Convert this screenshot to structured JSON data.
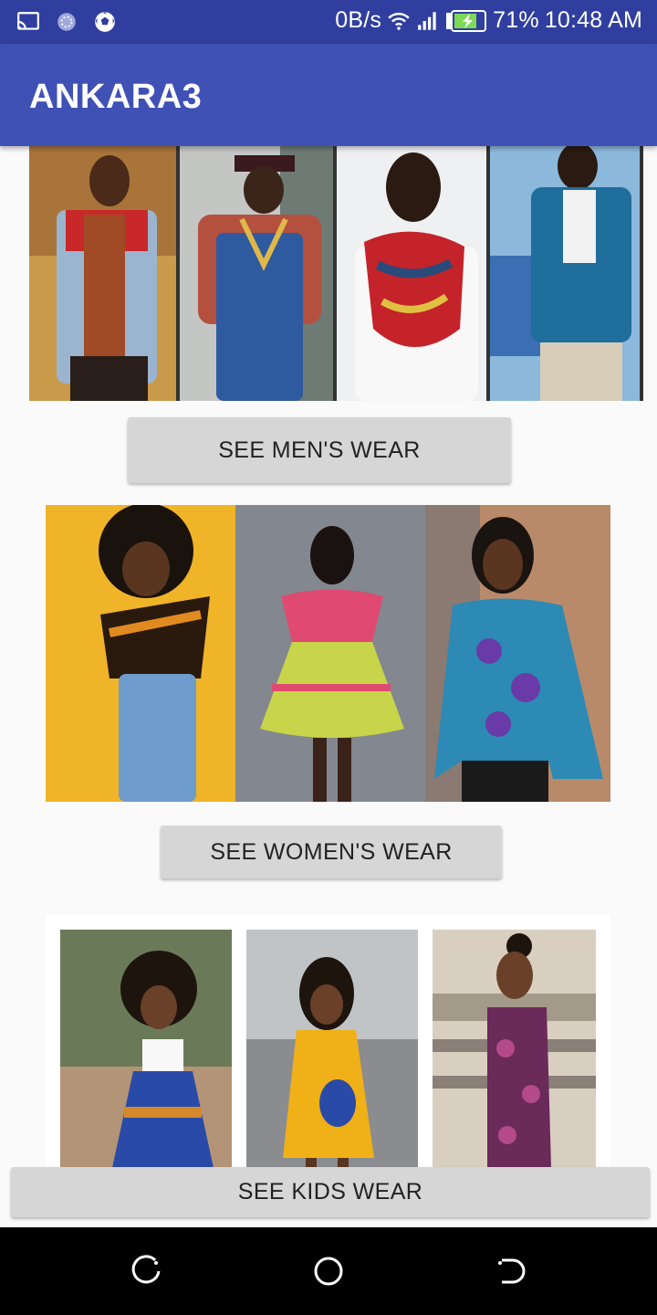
{
  "status_bar": {
    "left_icons": [
      "cast-icon",
      "sync-icon",
      "soccer-ball-icon"
    ],
    "network_speed": "0B/s",
    "battery_percent": "71%",
    "time": "10:48 AM",
    "right_icons": [
      "wifi-icon",
      "signal-icon",
      "battery-charging-icon"
    ]
  },
  "app_bar": {
    "title": "ANKARA3",
    "background": "#3f51b5",
    "status_background": "#303f9f"
  },
  "sections": [
    {
      "name": "mens",
      "button_label": "SEE MEN'S WEAR",
      "photo_panels": 4
    },
    {
      "name": "womens",
      "button_label": "SEE WOMEN'S WEAR",
      "photo_panels": 3
    },
    {
      "name": "kids",
      "button_label": "SEE KIDS WEAR",
      "photo_panels": 3
    }
  ],
  "nav_bar": {
    "buttons": [
      "recents-icon",
      "home-icon",
      "back-icon"
    ]
  },
  "colors": {
    "button": "#d6d6d6",
    "page": "#fafafa"
  }
}
